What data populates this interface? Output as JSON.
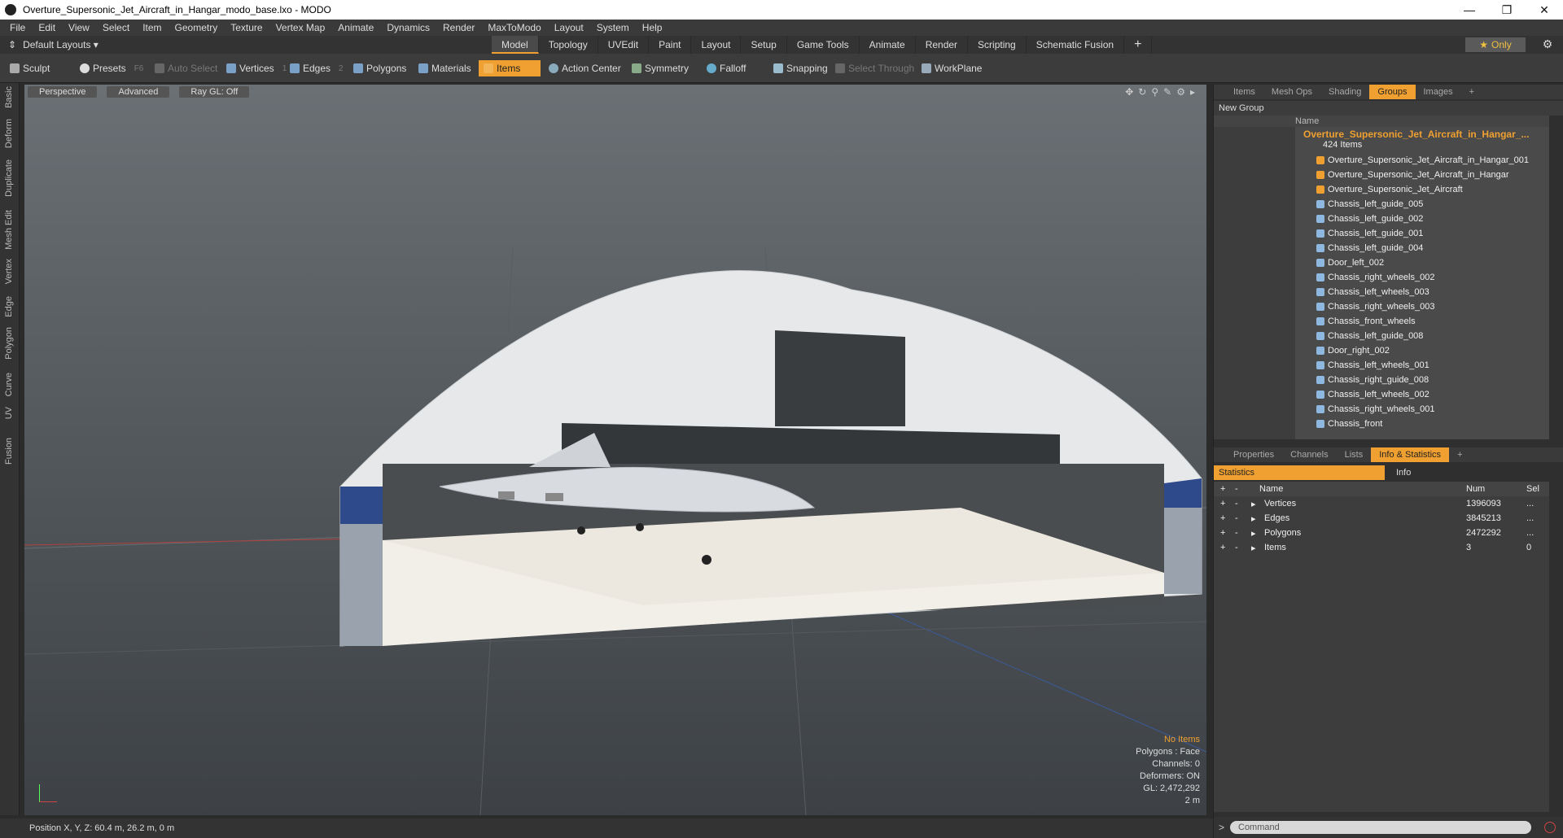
{
  "window": {
    "title": "Overture_Supersonic_Jet_Aircraft_in_Hangar_modo_base.lxo - MODO"
  },
  "menu": [
    "File",
    "Edit",
    "View",
    "Select",
    "Item",
    "Geometry",
    "Texture",
    "Vertex Map",
    "Animate",
    "Dynamics",
    "Render",
    "MaxToModo",
    "Layout",
    "System",
    "Help"
  ],
  "layout": {
    "label": "Default Layouts ▾"
  },
  "tabs": [
    "Model",
    "Topology",
    "UVEdit",
    "Paint",
    "Layout",
    "Setup",
    "Game Tools",
    "Animate",
    "Render",
    "Scripting",
    "Schematic Fusion"
  ],
  "only_label": "Only",
  "toolbar": {
    "sculpt": "Sculpt",
    "presets": "Presets",
    "presets_key": "F6",
    "auto_select": "Auto Select",
    "vertices": "Vertices",
    "vertices_key": "1",
    "edges": "Edges",
    "edges_key": "2",
    "polygons": "Polygons",
    "materials": "Materials",
    "items": "Items",
    "action_center": "Action Center",
    "symmetry": "Symmetry",
    "falloff": "Falloff",
    "snapping": "Snapping",
    "select_through": "Select Through",
    "workplane": "WorkPlane"
  },
  "left_tabs": [
    "Basic",
    "Deform",
    "Duplicate",
    "Mesh Edit",
    "Vertex",
    "Edge",
    "Polygon",
    "Curve",
    "UV",
    "Fusion"
  ],
  "viewport": {
    "view": "Perspective",
    "shading": "Advanced",
    "raygl": "Ray GL: Off",
    "info": {
      "items": "No Items",
      "polygons": "Polygons : Face",
      "channels": "Channels: 0",
      "deformers": "Deformers: ON",
      "gl": "GL: 2,472,292",
      "scale": "2 m"
    }
  },
  "status": "Position X, Y, Z:   60.4 m, 26.2 m, 0 m",
  "panel_top_tabs": [
    "Items",
    "Mesh Ops",
    "Shading",
    "Groups",
    "Images"
  ],
  "new_group": "New Group",
  "groups_header": "Name",
  "group_root": {
    "name": "Overture_Supersonic_Jet_Aircraft_in_Hangar_...",
    "count": "424 Items"
  },
  "group_items": [
    "Overture_Supersonic_Jet_Aircraft_in_Hangar_001",
    "Overture_Supersonic_Jet_Aircraft_in_Hangar",
    "Overture_Supersonic_Jet_Aircraft",
    "Chassis_left_guide_005",
    "Chassis_left_guide_002",
    "Chassis_left_guide_001",
    "Chassis_left_guide_004",
    "Door_left_002",
    "Chassis_right_wheels_002",
    "Chassis_left_wheels_003",
    "Chassis_right_wheels_003",
    "Chassis_front_wheels",
    "Chassis_left_guide_008",
    "Door_right_002",
    "Chassis_left_wheels_001",
    "Chassis_right_guide_008",
    "Chassis_left_wheels_002",
    "Chassis_right_wheels_001",
    "Chassis_front"
  ],
  "panel_bottom_tabs": [
    "Properties",
    "Channels",
    "Lists",
    "Info & Statistics"
  ],
  "stats_tab": "Statistics",
  "info_tab": "Info",
  "stats_columns": {
    "name": "Name",
    "num": "Num",
    "sel": "Sel"
  },
  "stats_rows": [
    {
      "name": "Vertices",
      "num": "1396093",
      "sel": "..."
    },
    {
      "name": "Edges",
      "num": "3845213",
      "sel": "..."
    },
    {
      "name": "Polygons",
      "num": "2472292",
      "sel": "..."
    },
    {
      "name": "Items",
      "num": "3",
      "sel": "0"
    }
  ],
  "command_placeholder": "Command"
}
